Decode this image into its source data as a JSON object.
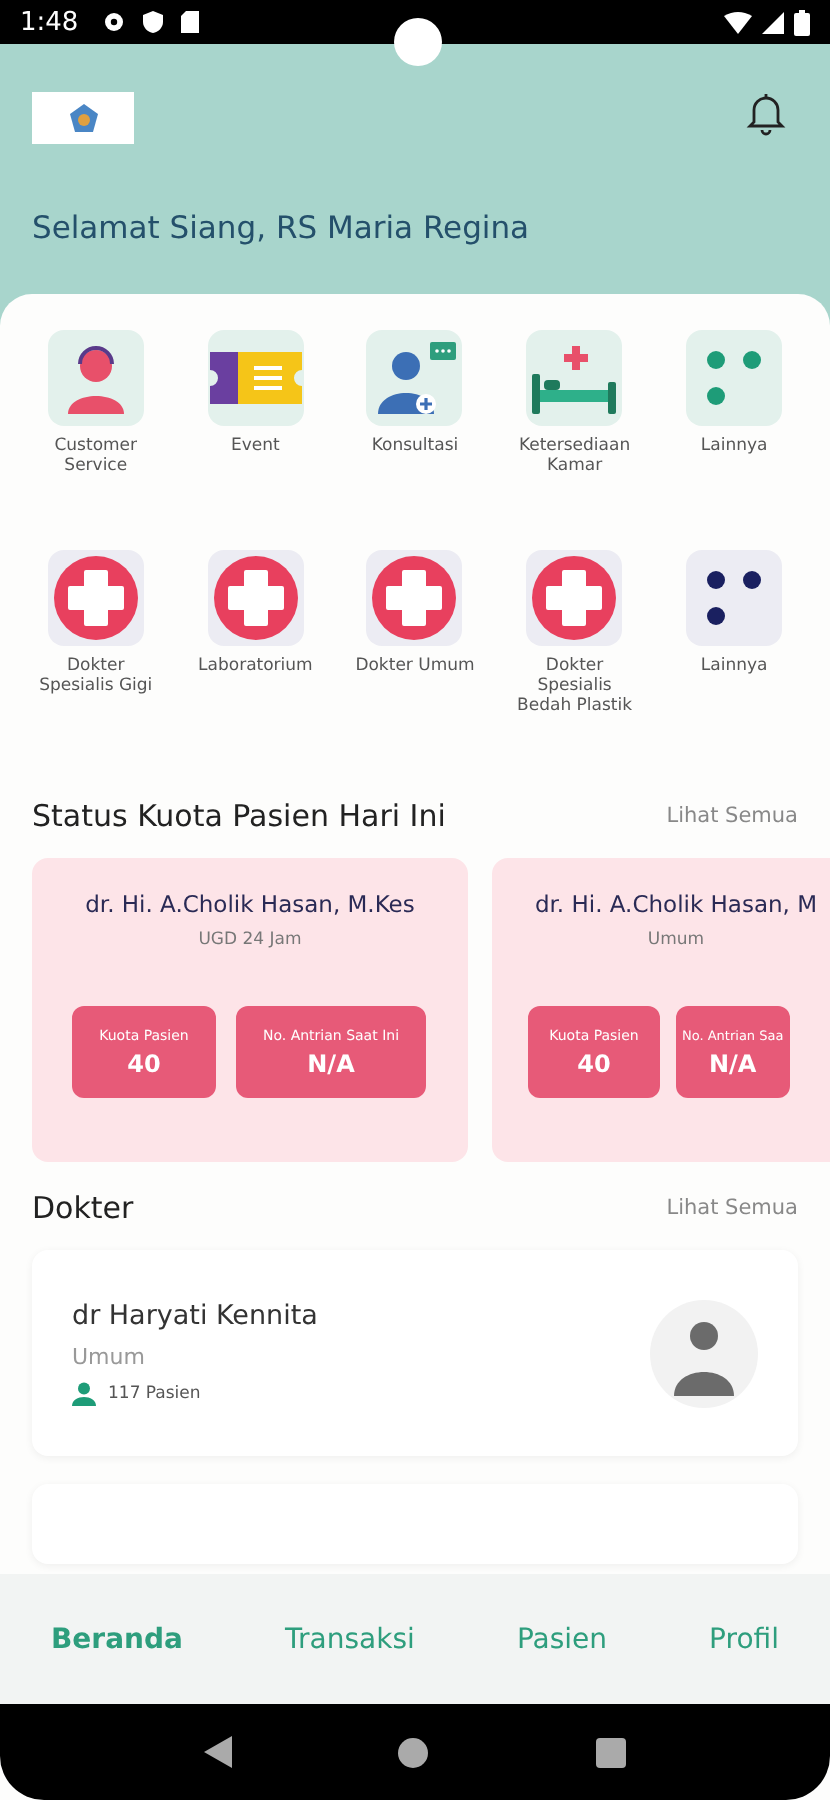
{
  "status_bar": {
    "time": "1:48"
  },
  "header": {
    "greeting": "Selamat Siang, RS Maria Regina"
  },
  "menu_rows": [
    {
      "items": [
        {
          "label": "Customer Service",
          "kind": "headset"
        },
        {
          "label": "Event",
          "kind": "ticket"
        },
        {
          "label": "Konsultasi",
          "kind": "consult"
        },
        {
          "label": "Ketersediaan Kamar",
          "kind": "bed"
        },
        {
          "label": "Lainnya",
          "kind": "dots"
        }
      ]
    },
    {
      "items": [
        {
          "label": "Dokter Spesialis Gigi",
          "kind": "cross"
        },
        {
          "label": "Laboratorium",
          "kind": "cross"
        },
        {
          "label": "Dokter Umum",
          "kind": "cross"
        },
        {
          "label": "Dokter Spesialis Bedah Plastik",
          "kind": "cross"
        },
        {
          "label": "Lainnya",
          "kind": "dotsdark"
        }
      ]
    }
  ],
  "quota_section": {
    "title": "Status Kuota Pasien Hari Ini",
    "link": "Lihat Semua",
    "cards": [
      {
        "doctor": "dr. Hi. A.Cholik Hasan, M.Kes",
        "unit": "UGD 24 Jam",
        "stats": [
          {
            "label": "Kuota Pasien",
            "value": "40"
          },
          {
            "label": "No. Antrian Saat Ini",
            "value": "N/A"
          }
        ]
      },
      {
        "doctor": "dr. Hi. A.Cholik Hasan, M",
        "unit": "Umum",
        "stats": [
          {
            "label": "Kuota Pasien",
            "value": "40"
          },
          {
            "label": "No. Antrian Saa",
            "value": "N/A"
          }
        ]
      }
    ]
  },
  "doctor_section": {
    "title": "Dokter",
    "link": "Lihat Semua",
    "doctors": [
      {
        "name": "dr Haryati Kennita",
        "specialty": "Umum",
        "patients": "117 Pasien"
      }
    ]
  },
  "bottom_nav": [
    {
      "label": "Beranda",
      "selected": true
    },
    {
      "label": "Transaksi",
      "selected": false
    },
    {
      "label": "Pasien",
      "selected": false
    },
    {
      "label": "Profil",
      "selected": false
    }
  ]
}
